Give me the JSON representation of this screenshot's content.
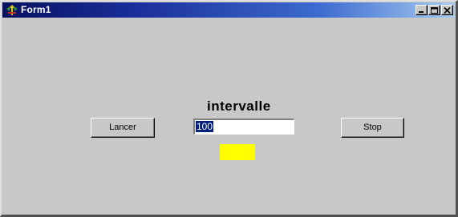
{
  "window": {
    "title": "Form1",
    "colors": {
      "title_start": "#07115f",
      "title_end": "#a6caf0",
      "face": "#c8c8c8"
    }
  },
  "icons": {
    "app": "form-app-icon",
    "minimize": "minimize-icon",
    "maximize": "maximize-icon",
    "close": "close-icon"
  },
  "form": {
    "label": "intervalle",
    "interval_value": "100",
    "start_button": "Lancer",
    "stop_button": "Stop",
    "indicator_color": "#ffff00"
  }
}
